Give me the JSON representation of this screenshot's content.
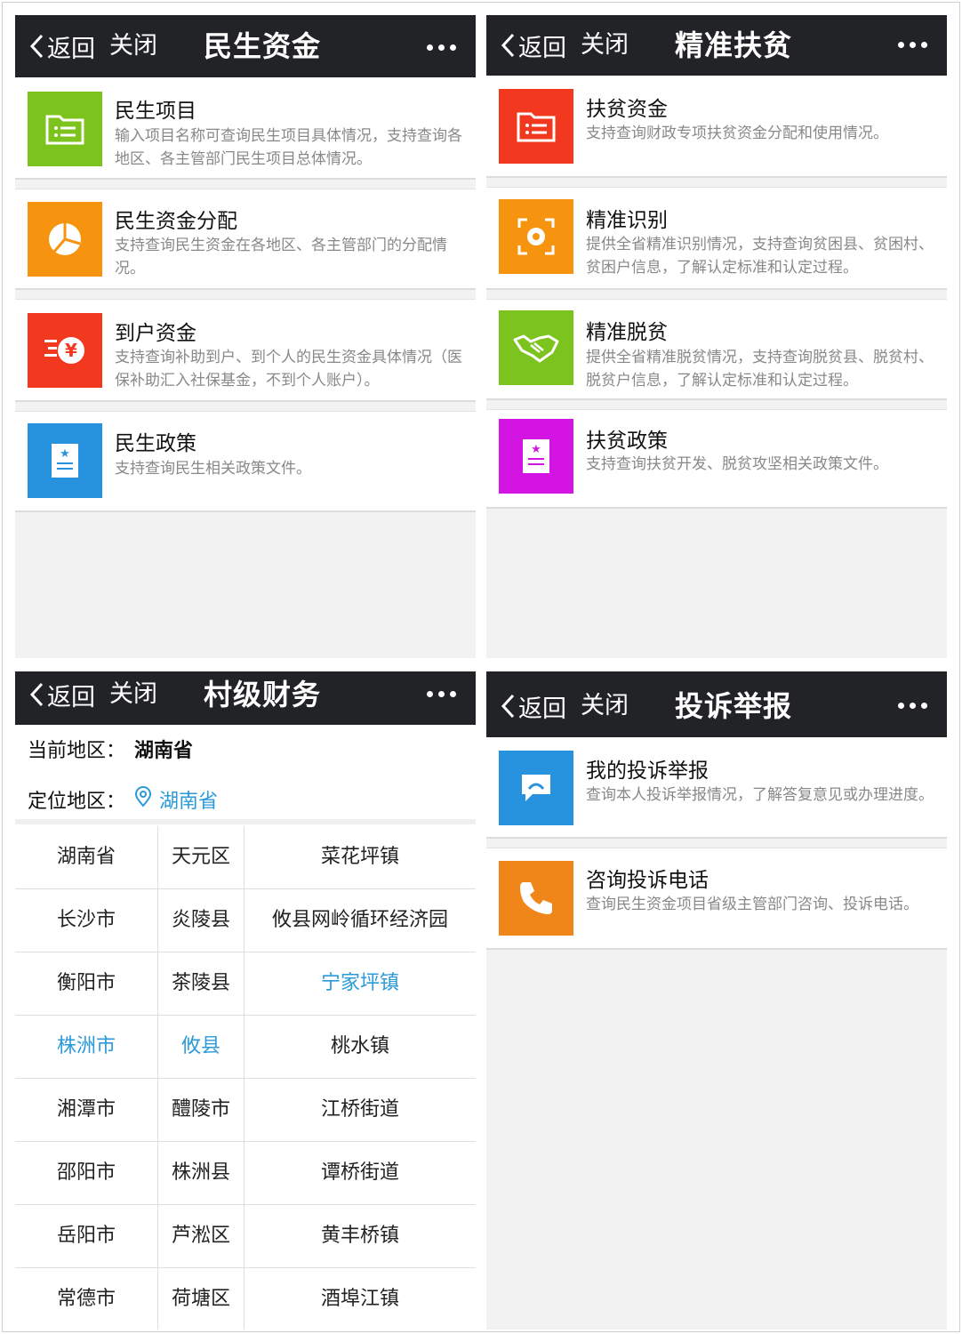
{
  "nav": {
    "back_label": "返回",
    "close_label": "关闭"
  },
  "panel1": {
    "title": "民生资金",
    "items": [
      {
        "title": "民生项目",
        "desc": "输入项目名称可查询民生项目具体情况，支持查询各地区、各主管部门民生项目总体情况。",
        "icon": "folder-list-icon",
        "color": "#7dc31d"
      },
      {
        "title": "民生资金分配",
        "desc": "支持查询民生资金在各地区、各主管部门的分配情况。",
        "icon": "pie-chart-icon",
        "color": "#f7940f"
      },
      {
        "title": "到户资金",
        "desc": "支持查询补助到户、到个人的民生资金具体情况（医保补助汇入社保基金，不到个人账户）。",
        "icon": "yuan-coin-icon",
        "color": "#f2391f"
      },
      {
        "title": "民生政策",
        "desc": "支持查询民生相关政策文件。",
        "icon": "policy-document-icon",
        "color": "#2792dd"
      }
    ]
  },
  "panel2": {
    "title": "精准扶贫",
    "items": [
      {
        "title": "扶贫资金",
        "desc": "支持查询财政专项扶贫资金分配和使用情况。",
        "icon": "folder-list-icon",
        "color": "#f2391f"
      },
      {
        "title": "精准识别",
        "desc": "提供全省精准识别情况，支持查询贫困县、贫困村、贫困户信息，了解认定标准和认定过程。",
        "icon": "target-scan-icon",
        "color": "#f7940f"
      },
      {
        "title": "精准脱贫",
        "desc": "提供全省精准脱贫情况，支持查询脱贫县、脱贫村、脱贫户信息，了解认定标准和认定过程。",
        "icon": "handshake-icon",
        "color": "#7dc31d"
      },
      {
        "title": "扶贫政策",
        "desc": "支持查询扶贫开发、脱贫攻坚相关政策文件。",
        "icon": "policy-document-icon",
        "color": "#d414e3"
      }
    ]
  },
  "panel3": {
    "title": "村级财务",
    "current_label": "当前地区：",
    "current_value": "湖南省",
    "located_label": "定位地区：",
    "located_value": "湖南省",
    "rows": [
      [
        "湖南省",
        "天元区",
        "菜花坪镇"
      ],
      [
        "长沙市",
        "炎陵县",
        "攸县网岭循环经济园"
      ],
      [
        "衡阳市",
        "茶陵县",
        "宁家坪镇"
      ],
      [
        "株洲市",
        "攸县",
        "桃水镇"
      ],
      [
        "湘潭市",
        "醴陵市",
        "江桥街道"
      ],
      [
        "邵阳市",
        "株洲县",
        "谭桥街道"
      ],
      [
        "岳阳市",
        "芦淞区",
        "黄丰桥镇"
      ],
      [
        "常德市",
        "荷塘区",
        "酒埠江镇"
      ]
    ],
    "highlight_color": "#2a9ad8"
  },
  "panel4": {
    "title": "投诉举报",
    "items": [
      {
        "title": "我的投诉举报",
        "desc": "查询本人投诉举报情况，了解答复意见或办理进度。",
        "icon": "chat-bubble-icon",
        "color": "#2792dd"
      },
      {
        "title": "咨询投诉电话",
        "desc": "查询民生资金项目省级主管部门咨询、投诉电话。",
        "icon": "phone-icon",
        "color": "#f08519"
      }
    ]
  }
}
